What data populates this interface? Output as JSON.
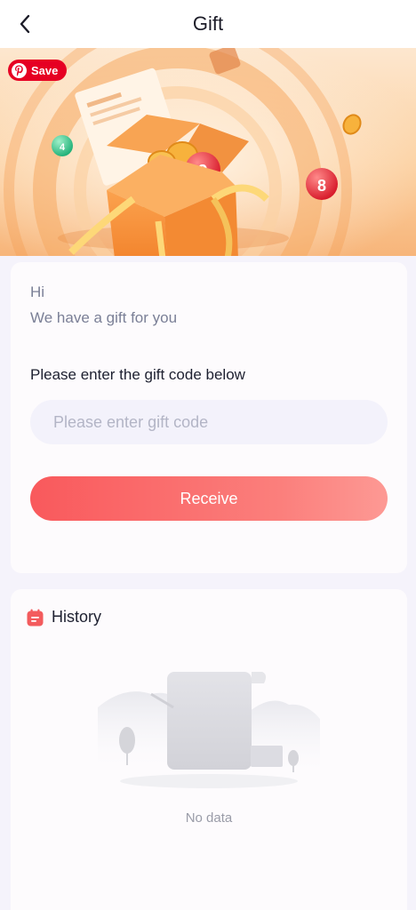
{
  "header": {
    "title": "Gift"
  },
  "banner": {
    "save_label": "Save",
    "ball_numbers": [
      "9",
      "8",
      "4"
    ]
  },
  "gift": {
    "greeting": "Hi",
    "subtitle": "We have a gift for you",
    "prompt": "Please enter the gift code below",
    "input_value": "",
    "input_placeholder": "Please enter gift code",
    "receive_label": "Receive"
  },
  "history": {
    "title": "History",
    "empty_text": "No data"
  },
  "colors": {
    "accent": "#f9595c",
    "accent_light": "#fd9994",
    "page_bg": "#f5f3fb",
    "banner_orange": "#f7b57a"
  }
}
